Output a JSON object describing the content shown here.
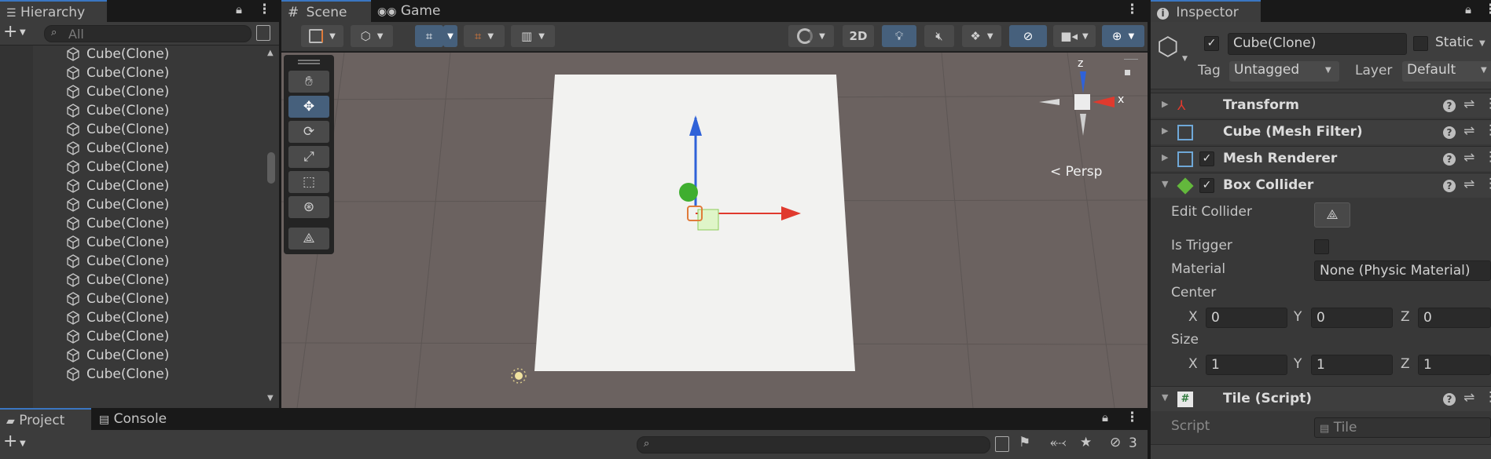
{
  "hierarchy": {
    "tab_label": "Hierarchy",
    "search_placeholder": "All",
    "items": [
      "Cube(Clone)",
      "Cube(Clone)",
      "Cube(Clone)",
      "Cube(Clone)",
      "Cube(Clone)",
      "Cube(Clone)",
      "Cube(Clone)",
      "Cube(Clone)",
      "Cube(Clone)",
      "Cube(Clone)",
      "Cube(Clone)",
      "Cube(Clone)",
      "Cube(Clone)",
      "Cube(Clone)",
      "Cube(Clone)",
      "Cube(Clone)",
      "Cube(Clone)",
      "Cube(Clone)"
    ]
  },
  "scene": {
    "tab_scene": "Scene",
    "tab_game": "Game",
    "btn_2d": "2D",
    "persp_label": "Persp",
    "gizmo_z": "z",
    "gizmo_x": "x"
  },
  "inspector": {
    "tab_label": "Inspector",
    "object_name": "Cube(Clone)",
    "static_label": "Static",
    "tag_label": "Tag",
    "tag_value": "Untagged",
    "layer_label": "Layer",
    "layer_value": "Default",
    "components": {
      "transform": "Transform",
      "mesh_filter": "Cube (Mesh Filter)",
      "mesh_renderer": "Mesh Renderer",
      "box_collider": "Box Collider",
      "tile_script": "Tile (Script)"
    },
    "box_collider": {
      "edit_collider": "Edit Collider",
      "is_trigger": "Is Trigger",
      "material_label": "Material",
      "material_value": "None (Physic Material)",
      "center_label": "Center",
      "size_label": "Size",
      "center": {
        "x": "0",
        "y": "0",
        "z": "0"
      },
      "size": {
        "x": "1",
        "y": "1",
        "z": "1"
      },
      "axis_x": "X",
      "axis_y": "Y",
      "axis_z": "Z"
    },
    "script_label": "Script",
    "script_value": "Tile"
  },
  "bottom": {
    "tab_project": "Project",
    "tab_console": "Console",
    "hidden_count": "3"
  },
  "colors": {
    "accent": "#3a76c2",
    "scene_bg": "#6b6260",
    "axis_x": "#e03a2e",
    "axis_y": "#4fb33b",
    "axis_z": "#2f62d8"
  }
}
